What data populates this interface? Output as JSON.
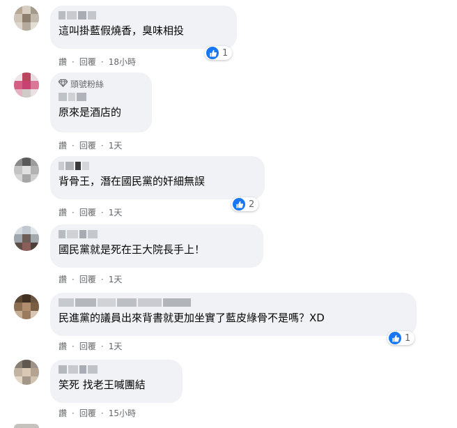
{
  "action_labels": {
    "like": "讚",
    "reply": "回覆",
    "separator": "·"
  },
  "fan_badge": "頭號粉絲",
  "comments": [
    {
      "text": "這叫掛藍假燒香，臭味相投",
      "time": "18小時",
      "reactions": "1",
      "reaction_icon": "like-icon"
    },
    {
      "text": "原來是酒店的",
      "time": "1天",
      "badge": true
    },
    {
      "text": "背骨王，潛在國民黨的奸細無誤",
      "time": "1天",
      "reactions": "2",
      "reaction_icon": "like-icon"
    },
    {
      "text": "國民黨就是死在王大院長手上！",
      "time": "1天"
    },
    {
      "text": "民進黨的議員出來背書就更加坐實了藍皮綠骨不是嗎？XD",
      "time": "1天",
      "reactions": "1",
      "reaction_icon": "like-icon"
    },
    {
      "text": "笑死 找老王喊團結",
      "time": "15小時"
    }
  ],
  "colors": {
    "bubble": "#f0f2f5",
    "meta": "#65676b",
    "like_blue": "#1877f2"
  }
}
